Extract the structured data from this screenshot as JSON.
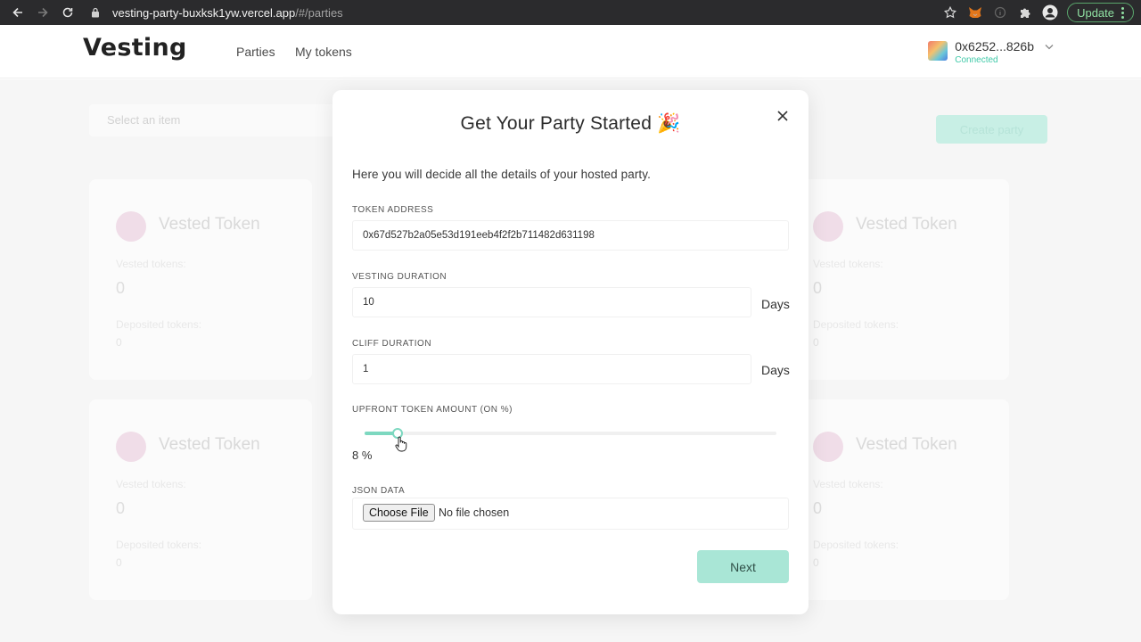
{
  "browser": {
    "url_host": "vesting-party-buxksk1yw.vercel.app",
    "url_path": "/#/parties",
    "update_label": "Update"
  },
  "header": {
    "logo": "Vesting",
    "nav": [
      "Parties",
      "My tokens"
    ],
    "wallet": {
      "address": "0x6252...826b",
      "status": "Connected"
    }
  },
  "background": {
    "select_placeholder": "Select an item",
    "create_button": "Create party",
    "card_title": "Vested Token",
    "card_vested_label": "Vested tokens:",
    "card_vested_value": "0",
    "card_deposited_label": "Deposited tokens:",
    "card_deposited_value": "0"
  },
  "modal": {
    "title": "Get Your Party Started 🎉",
    "intro": "Here you will decide all the details of your hosted party.",
    "token_address": {
      "label": "TOKEN ADDRESS",
      "value": "0x67d527b2a05e53d191eeb4f2f2b711482d631198"
    },
    "vesting_duration": {
      "label": "VESTING DURATION",
      "value": "10",
      "unit": "Days"
    },
    "cliff_duration": {
      "label": "CLIFF DURATION",
      "value": "1",
      "unit": "Days"
    },
    "upfront": {
      "label": "UPFRONT TOKEN AMOUNT (ON %)",
      "percent": 8,
      "display": "8 %"
    },
    "json_data": {
      "label": "JSON DATA",
      "button": "Choose File",
      "status": "No file chosen"
    },
    "next_label": "Next"
  },
  "colors": {
    "accent": "#7dd8c0",
    "next_button": "#a9e6d6",
    "connected": "#3fc9a8"
  }
}
